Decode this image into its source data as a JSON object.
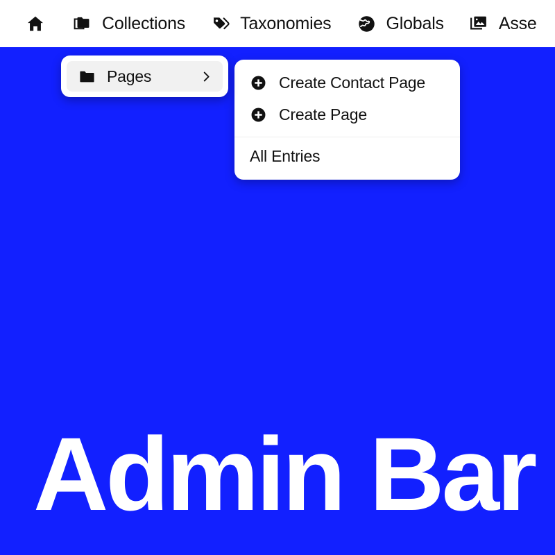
{
  "theme": {
    "background": "#1220ff",
    "bar_background": "#ffffff",
    "panel_background": "#ffffff",
    "panel_row_highlight": "#f1f1f1",
    "text": "#111111",
    "title_text": "#ffffff",
    "divider": "#ededed"
  },
  "admin_bar": {
    "items": [
      {
        "icon": "home-icon",
        "label": ""
      },
      {
        "icon": "folders-icon",
        "label": "Collections"
      },
      {
        "icon": "tags-icon",
        "label": "Taxonomies"
      },
      {
        "icon": "globe-icon",
        "label": "Globals"
      },
      {
        "icon": "images-icon",
        "label": "Asse"
      }
    ]
  },
  "pages_menu": {
    "icon": "folder-icon",
    "label": "Pages",
    "chevron": "chevron-right-icon"
  },
  "submenu": {
    "items": [
      {
        "icon": "plus-circle-icon",
        "label": "Create Contact Page"
      },
      {
        "icon": "plus-circle-icon",
        "label": "Create Page"
      }
    ],
    "footer_label": "All Entries"
  },
  "hero": {
    "title": "Admin Bar"
  }
}
